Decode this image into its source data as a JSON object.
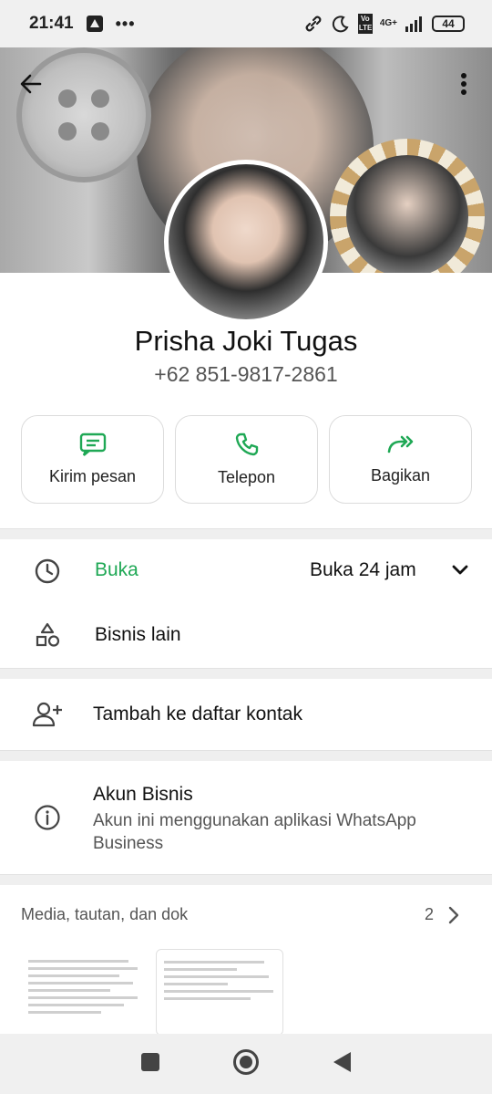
{
  "status_bar": {
    "time": "21:41",
    "network": "4G+",
    "volte": "Vo LTE",
    "battery": "44"
  },
  "profile": {
    "name": "Prisha Joki Tugas",
    "phone": "+62 851-9817-2861"
  },
  "actions": [
    {
      "label": "Kirim pesan",
      "icon": "message-icon"
    },
    {
      "label": "Telepon",
      "icon": "phone-icon"
    },
    {
      "label": "Bagikan",
      "icon": "share-icon"
    }
  ],
  "hours": {
    "status": "Buka",
    "detail": "Buka 24 jam"
  },
  "other_business": "Bisnis lain",
  "add_contact": "Tambah ke daftar kontak",
  "business_account": {
    "title": "Akun Bisnis",
    "description": "Akun ini menggunakan aplikasi WhatsApp Business"
  },
  "media": {
    "title": "Media, tautan, dan dok",
    "count": "2"
  },
  "colors": {
    "accent": "#1fa855"
  }
}
